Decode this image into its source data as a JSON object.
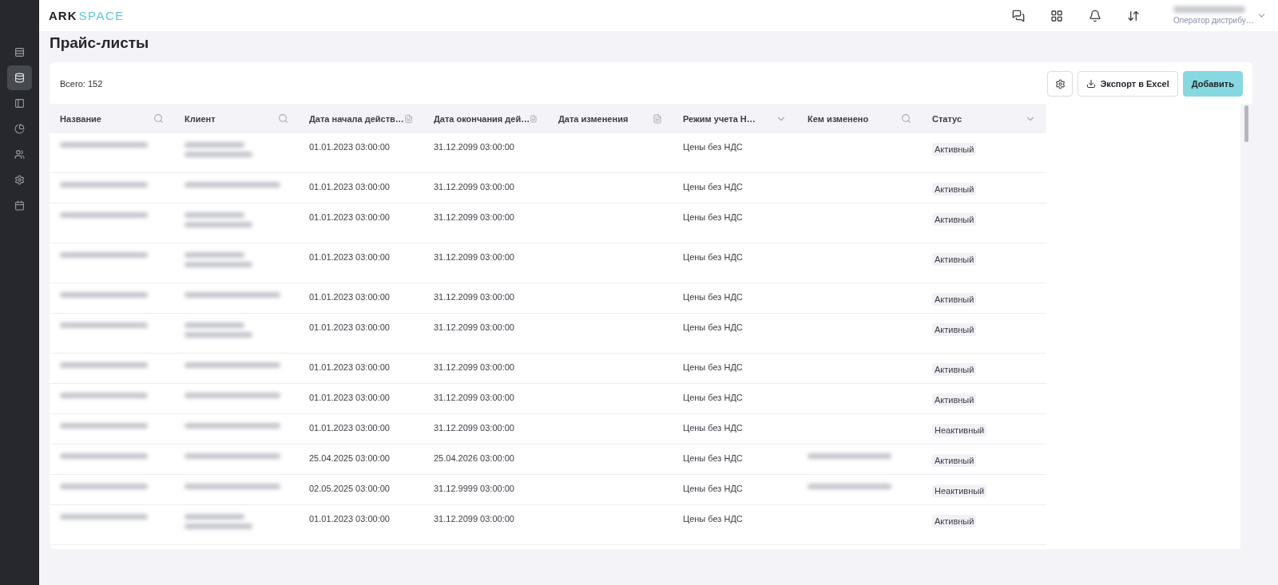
{
  "logo": {
    "dark": "ARK",
    "light": "SPACE"
  },
  "sidebar": {
    "items": [
      {
        "selected": false
      },
      {
        "selected": true
      },
      {
        "selected": false
      },
      {
        "selected": false
      },
      {
        "selected": false
      },
      {
        "selected": false
      },
      {
        "selected": false
      }
    ]
  },
  "header": {
    "user": {
      "role": "Оператор дистрибу…"
    }
  },
  "page_title": "Прайс-листы",
  "toolbar": {
    "total": "Всего: 152",
    "export": "Экспорт в Excel",
    "add": "Добавить"
  },
  "table": {
    "columns": [
      {
        "label": "Название",
        "kind": "search"
      },
      {
        "label": "Клиент",
        "kind": "search"
      },
      {
        "label": "Дата начала действ…",
        "kind": "date"
      },
      {
        "label": "Дата окончания дей…",
        "kind": "date"
      },
      {
        "label": "Дата изменения",
        "kind": "date"
      },
      {
        "label": "Режим учета Н…",
        "kind": "select"
      },
      {
        "label": "Кем изменено",
        "kind": "search"
      },
      {
        "label": "Статус",
        "kind": "select"
      }
    ],
    "rows": [
      {
        "client_wrapped": true,
        "start": "01.01.2023 03:00:00",
        "end": "31.12.2099 03:00:00",
        "vat_mode": "Цены без НДС",
        "modified_by_redacted": false,
        "status": "Активный"
      },
      {
        "client_wrapped": false,
        "start": "01.01.2023 03:00:00",
        "end": "31.12.2099 03:00:00",
        "vat_mode": "Цены без НДС",
        "modified_by_redacted": false,
        "status": "Активный"
      },
      {
        "client_wrapped": true,
        "start": "01.01.2023 03:00:00",
        "end": "31.12.2099 03:00:00",
        "vat_mode": "Цены без НДС",
        "modified_by_redacted": false,
        "status": "Активный"
      },
      {
        "client_wrapped": true,
        "start": "01.01.2023 03:00:00",
        "end": "31.12.2099 03:00:00",
        "vat_mode": "Цены без НДС",
        "modified_by_redacted": false,
        "status": "Активный"
      },
      {
        "client_wrapped": false,
        "start": "01.01.2023 03:00:00",
        "end": "31.12.2099 03:00:00",
        "vat_mode": "Цены без НДС",
        "modified_by_redacted": false,
        "status": "Активный"
      },
      {
        "client_wrapped": true,
        "start": "01.01.2023 03:00:00",
        "end": "31.12.2099 03:00:00",
        "vat_mode": "Цены без НДС",
        "modified_by_redacted": false,
        "status": "Активный"
      },
      {
        "client_wrapped": false,
        "start": "01.01.2023 03:00:00",
        "end": "31.12.2099 03:00:00",
        "vat_mode": "Цены без НДС",
        "modified_by_redacted": false,
        "status": "Активный"
      },
      {
        "client_wrapped": false,
        "start": "01.01.2023 03:00:00",
        "end": "31.12.2099 03:00:00",
        "vat_mode": "Цены без НДС",
        "modified_by_redacted": false,
        "status": "Активный"
      },
      {
        "client_wrapped": false,
        "start": "01.01.2023 03:00:00",
        "end": "31.12.2099 03:00:00",
        "vat_mode": "Цены без НДС",
        "modified_by_redacted": false,
        "status": "Неактивный"
      },
      {
        "client_wrapped": false,
        "start": "25.04.2025 03:00:00",
        "end": "25.04.2026 03:00:00",
        "vat_mode": "Цены без НДС",
        "modified_by_redacted": true,
        "status": "Активный"
      },
      {
        "client_wrapped": false,
        "start": "02.05.2025 03:00:00",
        "end": "31.12.9999 03:00:00",
        "vat_mode": "Цены без НДС",
        "modified_by_redacted": true,
        "status": "Неактивный"
      },
      {
        "client_wrapped": true,
        "start": "01.01.2023 03:00:00",
        "end": "31.12.2099 03:00:00",
        "vat_mode": "Цены без НДС",
        "modified_by_redacted": false,
        "status": "Активный"
      }
    ]
  }
}
